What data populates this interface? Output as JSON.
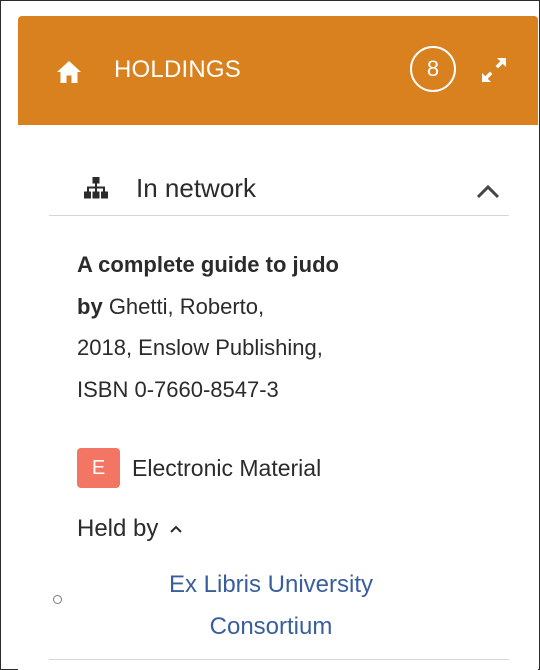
{
  "header": {
    "title": "HOLDINGS",
    "count": "8",
    "icons": [
      "home-icon",
      "expand-icon"
    ],
    "color": "#d9801f"
  },
  "section": {
    "title": "In network",
    "icons": [
      "network-icon",
      "chevron-up-icon"
    ],
    "expanded": true
  },
  "record": {
    "title": "A complete guide to judo",
    "by_label": "by",
    "author": "Ghetti, Roberto,",
    "publication": "2018, Enslow Publishing,",
    "isbn": "ISBN 0-7660-8547-3"
  },
  "material": {
    "badge": "E",
    "label": "Electronic Material",
    "badge_color": "#f27663"
  },
  "held_by": {
    "label": "Held by",
    "expanded": true,
    "institutions": [
      {
        "name_line1": "Ex Libris University",
        "name_line2": "Consortium",
        "link_color": "#3a5e9d"
      }
    ]
  }
}
